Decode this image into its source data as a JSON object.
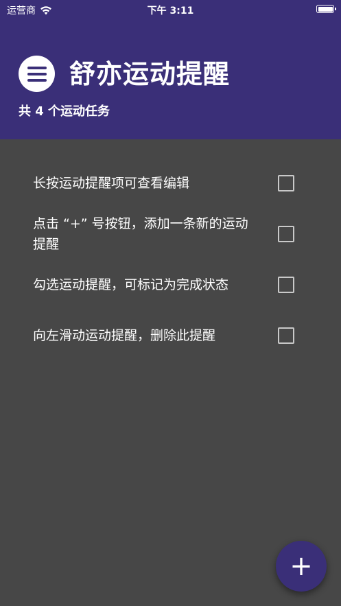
{
  "status_bar": {
    "carrier": "运营商",
    "time": "下午 3:11"
  },
  "header": {
    "title": "舒亦运动提醒",
    "task_count": "共 4 个运动任务"
  },
  "tasks": [
    {
      "text": "长按运动提醒项可查看编辑",
      "checked": false
    },
    {
      "text": "点击 “+” 号按钮，添加一条新的运动提醒",
      "checked": false
    },
    {
      "text": "勾选运动提醒，可标记为完成状态",
      "checked": false
    },
    {
      "text": "向左滑动运动提醒，删除此提醒",
      "checked": false
    }
  ],
  "fab": {
    "label": "+"
  },
  "colors": {
    "header_bg": "#3a2f78",
    "body_bg": "#474747",
    "text": "#ffffff",
    "checkbox_border": "#c9c9c9"
  },
  "icons": {
    "menu": "menu-icon",
    "wifi": "wifi-icon",
    "battery": "battery-icon",
    "add": "plus-icon"
  }
}
